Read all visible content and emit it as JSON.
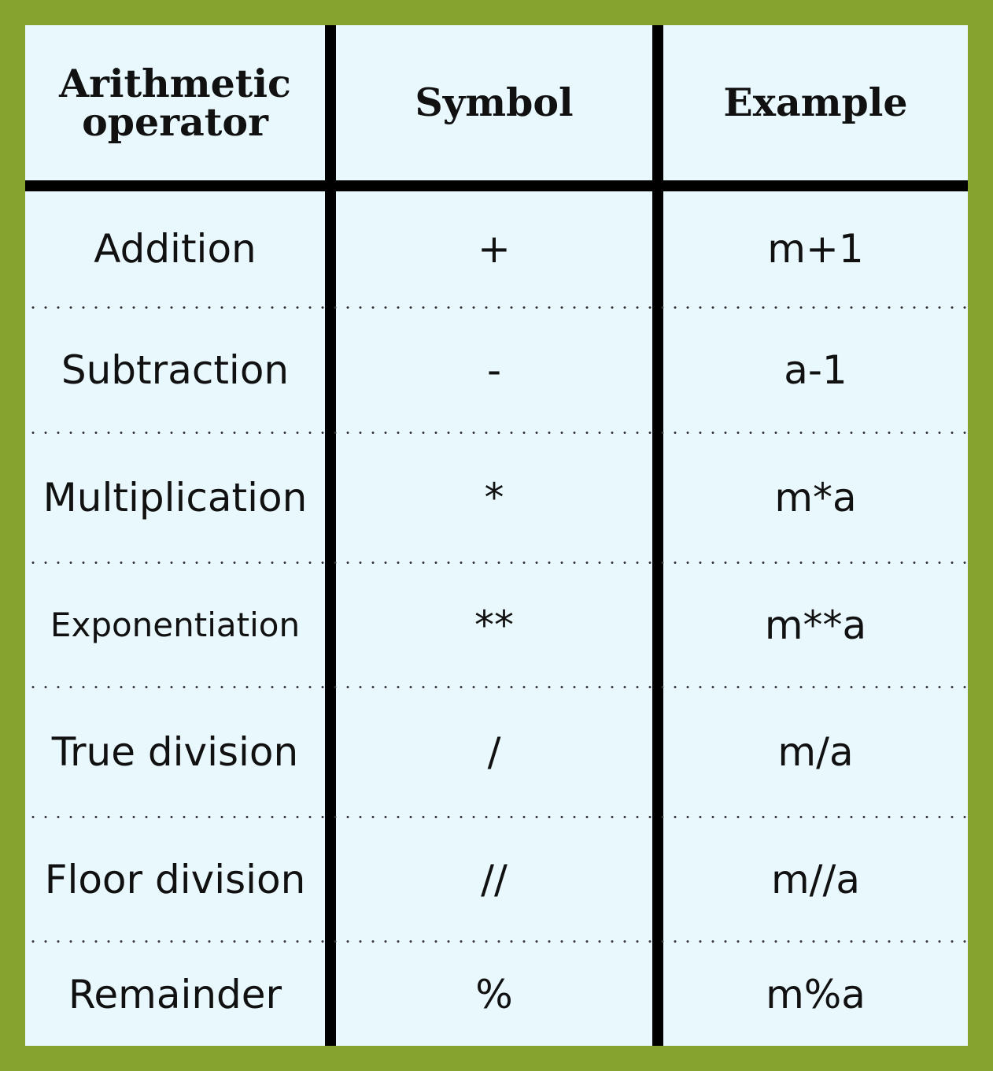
{
  "table": {
    "headers": [
      "Arithmetic operator",
      "Symbol",
      "Example"
    ],
    "rows": [
      {
        "operator": "Addition",
        "symbol": "+",
        "example": "m+1"
      },
      {
        "operator": "Subtraction",
        "symbol": "-",
        "example": "a-1"
      },
      {
        "operator": "Multiplication",
        "symbol": "*",
        "example": "m*a"
      },
      {
        "operator": "Exponentiation",
        "symbol": "**",
        "example": "m**a"
      },
      {
        "operator": "True division",
        "symbol": "/",
        "example": "m/a"
      },
      {
        "operator": "Floor division",
        "symbol": "//",
        "example": "m//a"
      },
      {
        "operator": "Remainder",
        "symbol": "%",
        "example": "m%a"
      }
    ]
  },
  "colors": {
    "frame": "#86a22f",
    "background": "#e8f8fd",
    "rule": "#000000"
  }
}
